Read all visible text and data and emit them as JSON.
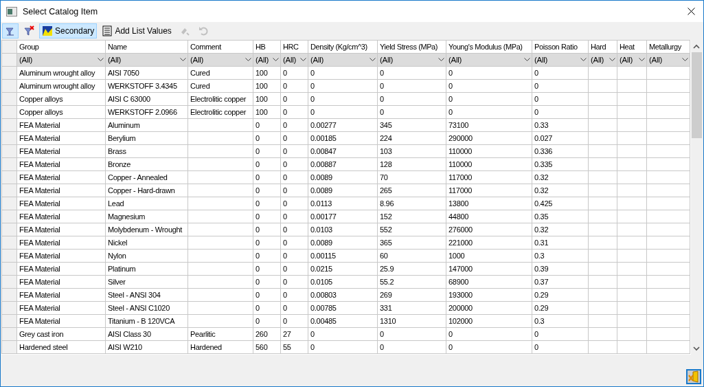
{
  "window": {
    "title": "Select Catalog Item"
  },
  "toolbar": [
    {
      "kind": "icon",
      "pressed": true,
      "disabled": false
    },
    {
      "kind": "icon",
      "pressed": false,
      "disabled": false
    },
    {
      "kind": "text",
      "label": "Secondary",
      "pressed": true,
      "disabled": false
    },
    {
      "kind": "text",
      "label": "Add List Values",
      "pressed": false,
      "disabled": false
    },
    {
      "kind": "icon",
      "pressed": false,
      "disabled": true
    },
    {
      "kind": "icon",
      "pressed": false,
      "disabled": true
    }
  ],
  "table": {
    "columns": [
      "Group",
      "Name",
      "Comment",
      "HB",
      "HRC",
      "Density (Kg/cm^3)",
      "Yield Stress (MPa)",
      "Young's Modulus (MPa)",
      "Poisson Ratio",
      "Hard",
      "Heat",
      "Metallurgy"
    ],
    "filters": [
      "(All)",
      "(All)",
      "(All)",
      "(All)",
      "(All)",
      "(All)",
      "(All)",
      "(All)",
      "(All)",
      "(All)",
      "(All)",
      "(All)"
    ],
    "rows": [
      [
        "Aluminum wrought alloy",
        "AISI 7050",
        "Cured",
        "100",
        "0",
        "0",
        "0",
        "0",
        "0",
        "",
        "",
        ""
      ],
      [
        "Aluminum wrought alloy",
        "WERKSTOFF 3.4345",
        "Cured",
        "100",
        "0",
        "0",
        "0",
        "0",
        "0",
        "",
        "",
        ""
      ],
      [
        "Copper alloys",
        "AISI C 63000",
        "Electrolitic copper",
        "100",
        "0",
        "0",
        "0",
        "0",
        "0",
        "",
        "",
        ""
      ],
      [
        "Copper alloys",
        "WERKSTOFF 2.0966",
        "Electrolitic copper",
        "100",
        "0",
        "0",
        "0",
        "0",
        "0",
        "",
        "",
        ""
      ],
      [
        "FEA Material",
        "Aluminum",
        "",
        "0",
        "0",
        "0.00277",
        "345",
        "73100",
        "0.33",
        "",
        "",
        ""
      ],
      [
        "FEA Material",
        "Berylium",
        "",
        "0",
        "0",
        "0.00185",
        "224",
        "290000",
        "0.027",
        "",
        "",
        ""
      ],
      [
        "FEA Material",
        "Brass",
        "",
        "0",
        "0",
        "0.00847",
        "103",
        "110000",
        "0.336",
        "",
        "",
        ""
      ],
      [
        "FEA Material",
        "Bronze",
        "",
        "0",
        "0",
        "0.00887",
        "128",
        "110000",
        "0.335",
        "",
        "",
        ""
      ],
      [
        "FEA Material",
        "Copper - Annealed",
        "",
        "0",
        "0",
        "0.0089",
        "70",
        "117000",
        "0.32",
        "",
        "",
        ""
      ],
      [
        "FEA Material",
        "Copper - Hard-drawn",
        "",
        "0",
        "0",
        "0.0089",
        "265",
        "117000",
        "0.32",
        "",
        "",
        ""
      ],
      [
        "FEA Material",
        "Lead",
        "",
        "0",
        "0",
        "0.0113",
        "8.96",
        "13800",
        "0.425",
        "",
        "",
        ""
      ],
      [
        "FEA Material",
        "Magnesium",
        "",
        "0",
        "0",
        "0.00177",
        "152",
        "44800",
        "0.35",
        "",
        "",
        ""
      ],
      [
        "FEA Material",
        "Molybdenum - Wrought",
        "",
        "0",
        "0",
        "0.0103",
        "552",
        "276000",
        "0.32",
        "",
        "",
        ""
      ],
      [
        "FEA Material",
        "Nickel",
        "",
        "0",
        "0",
        "0.0089",
        "365",
        "221000",
        "0.31",
        "",
        "",
        ""
      ],
      [
        "FEA Material",
        "Nylon",
        "",
        "0",
        "0",
        "0.00115",
        "60",
        "1000",
        "0.3",
        "",
        "",
        ""
      ],
      [
        "FEA Material",
        "Platinum",
        "",
        "0",
        "0",
        "0.0215",
        "25.9",
        "147000",
        "0.39",
        "",
        "",
        ""
      ],
      [
        "FEA Material",
        "Silver",
        "",
        "0",
        "0",
        "0.0105",
        "55.2",
        "68900",
        "0.37",
        "",
        "",
        ""
      ],
      [
        "FEA Material",
        "Steel - ANSI 304",
        "",
        "0",
        "0",
        "0.00803",
        "269",
        "193000",
        "0.29",
        "",
        "",
        ""
      ],
      [
        "FEA Material",
        "Steel - ANSI C1020",
        "",
        "0",
        "0",
        "0.00785",
        "331",
        "200000",
        "0.29",
        "",
        "",
        ""
      ],
      [
        "FEA Material",
        "Titanium - B 120VCA",
        "",
        "0",
        "0",
        "0.00485",
        "1310",
        "102000",
        "0.3",
        "",
        "",
        ""
      ],
      [
        "Grey cast iron",
        "AISI Class 30",
        "Pearlitic",
        "260",
        "27",
        "0",
        "0",
        "0",
        "0",
        "",
        "",
        ""
      ],
      [
        "Hardened steel",
        "AISI W210",
        "Hardened",
        "560",
        "55",
        "0",
        "0",
        "0",
        "0",
        "",
        "",
        ""
      ]
    ]
  }
}
